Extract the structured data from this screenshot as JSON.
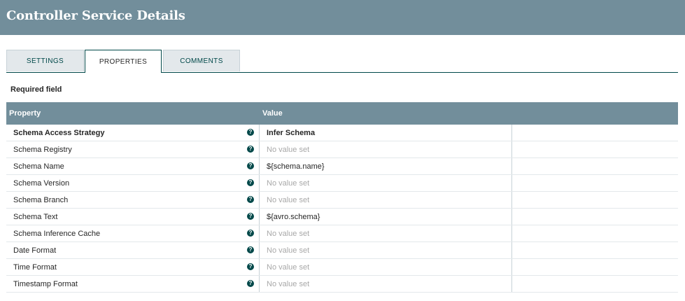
{
  "dialog": {
    "title": "Controller Service Details"
  },
  "tabs": [
    {
      "label": "SETTINGS",
      "active": false
    },
    {
      "label": "PROPERTIES",
      "active": true
    },
    {
      "label": "COMMENTS",
      "active": false
    }
  ],
  "required_label": "Required field",
  "grid": {
    "headers": {
      "property": "Property",
      "value": "Value"
    },
    "rows": [
      {
        "property": "Schema Access Strategy",
        "value": "Infer Schema",
        "required": true,
        "is_set": true
      },
      {
        "property": "Schema Registry",
        "value": "No value set",
        "required": false,
        "is_set": false
      },
      {
        "property": "Schema Name",
        "value": "${schema.name}",
        "required": false,
        "is_set": true
      },
      {
        "property": "Schema Version",
        "value": "No value set",
        "required": false,
        "is_set": false
      },
      {
        "property": "Schema Branch",
        "value": "No value set",
        "required": false,
        "is_set": false
      },
      {
        "property": "Schema Text",
        "value": "${avro.schema}",
        "required": false,
        "is_set": true
      },
      {
        "property": "Schema Inference Cache",
        "value": "No value set",
        "required": false,
        "is_set": false
      },
      {
        "property": "Date Format",
        "value": "No value set",
        "required": false,
        "is_set": false
      },
      {
        "property": "Time Format",
        "value": "No value set",
        "required": false,
        "is_set": false
      },
      {
        "property": "Timestamp Format",
        "value": "No value set",
        "required": false,
        "is_set": false
      }
    ]
  },
  "icons": {
    "help": "help-circle-icon",
    "help_glyph": "?"
  },
  "colors": {
    "header_bg": "#728e9b",
    "accent": "#004849",
    "tab_inactive_bg": "#e3e8eb",
    "empty_value_text": "#a8a8a8"
  }
}
